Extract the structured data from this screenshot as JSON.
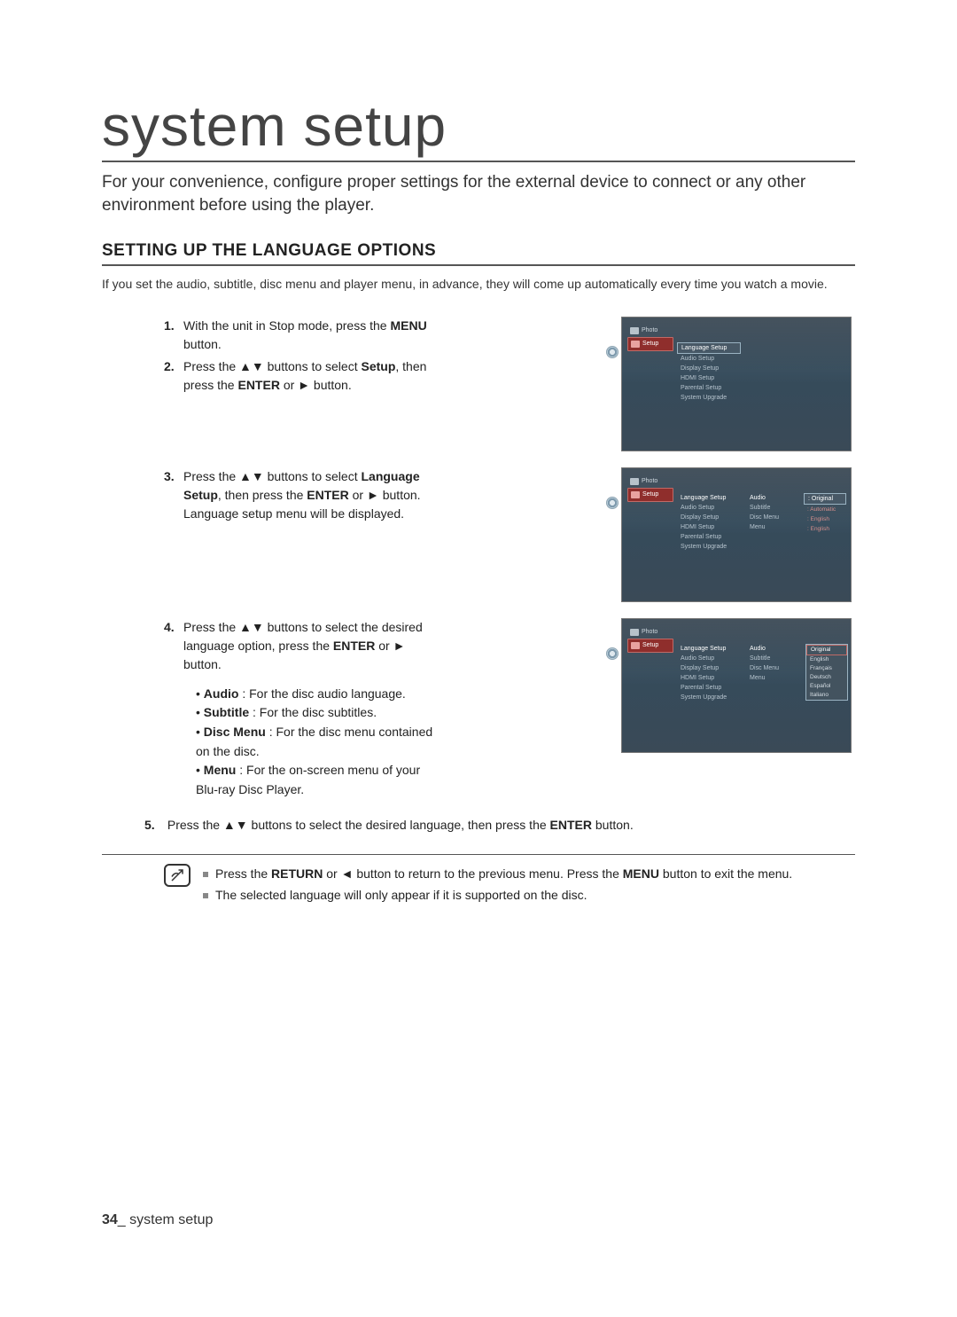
{
  "page": {
    "number": "34",
    "footer_label": "system setup",
    "title": "system setup",
    "intro": "For your convenience, configure proper settings for the external device to connect or any other environment before using the player."
  },
  "section": {
    "heading": "SETTING UP THE LANGUAGE OPTIONS",
    "sub": "If you set the audio, subtitle, disc menu and player menu, in advance, they will come up automatically every time you watch a movie."
  },
  "steps": {
    "s1_a": "With the unit in Stop mode, press the ",
    "s1_b": "MENU",
    "s1_c": " button.",
    "s2_a": "Press the ",
    "s2_arrows": "▲▼",
    "s2_b": " buttons to select ",
    "s2_setup": "Setup",
    "s2_c": ", then press the ",
    "s2_enter": "ENTER",
    "s2_d": " or ",
    "s2_play": "►",
    "s2_e": " button.",
    "s3_a": "Press the ",
    "s3_arrows": "▲▼",
    "s3_b": " buttons to select ",
    "s3_lang": "Language Setup",
    "s3_c": ", then press the ",
    "s3_enter": "ENTER",
    "s3_d": " or ",
    "s3_play": "►",
    "s3_e": " button. Language setup menu will be displayed.",
    "s4_a": "Press the ",
    "s4_arrows": "▲▼",
    "s4_b": " buttons to select the desired language option, press the ",
    "s4_enter": "ENTER",
    "s4_c": " or ",
    "s4_play": "►",
    "s4_d": " button.",
    "s5_a": "Press the ",
    "s5_arrows": "▲▼",
    "s5_b": " buttons to select the desired language, then press the ",
    "s5_enter": "ENTER",
    "s5_c": " button."
  },
  "bullets": {
    "b1_k": "Audio",
    "b1_v": " : For the disc audio language.",
    "b2_k": "Subtitle",
    "b2_v": " : For the disc subtitles.",
    "b3_k": "Disc Menu",
    "b3_v": " : For the disc menu contained on the disc.",
    "b4_k": "Menu",
    "b4_v": " : For the on-screen menu of your Blu-ray Disc Player."
  },
  "notes": {
    "n1_a": "Press the ",
    "n1_return": "RETURN",
    "n1_b": " or ",
    "n1_back": "◄",
    "n1_c": " button to return to the previous menu. Press the ",
    "n1_menu": "MENU",
    "n1_d": " button to exit the menu.",
    "n2": "The selected language will only appear if it is supported on the disc."
  },
  "screen": {
    "side_photo": "Photo",
    "side_setup": "Setup",
    "menu": {
      "language_setup": "Language Setup",
      "audio_setup": "Audio Setup",
      "display_setup": "Display Setup",
      "hdmi_setup": "HDMI Setup",
      "parental_setup": "Parental Setup",
      "system_upgrade": "System Upgrade"
    },
    "opts": {
      "audio": "Audio",
      "subtitle": "Subtitle",
      "disc_menu": "Disc Menu",
      "menu": "Menu"
    },
    "vals": {
      "original": ": Original",
      "automatic": ": Automatic",
      "english": ": English"
    },
    "popup": {
      "original": "Original",
      "english": "English",
      "francais": "Français",
      "deutsch": "Deutsch",
      "espanol": "Español",
      "italiano": "Italiano"
    }
  }
}
